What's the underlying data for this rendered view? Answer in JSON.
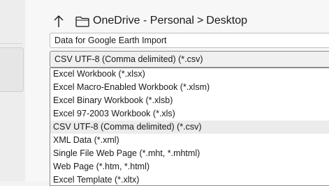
{
  "breadcrumb": {
    "location": "OneDrive - Personal",
    "separator": ">",
    "folder": "Desktop"
  },
  "icons": {
    "up": "up-arrow-icon",
    "folder": "folder-icon"
  },
  "file_name": {
    "value": "Data for Google Earth Import"
  },
  "save_as_type": {
    "selected": "CSV UTF-8 (Comma delimited) (*.csv)",
    "options": [
      "Excel Workbook (*.xlsx)",
      "Excel Macro-Enabled Workbook (*.xlsm)",
      "Excel Binary Workbook (*.xlsb)",
      "Excel 97-2003 Workbook (*.xls)",
      "CSV UTF-8 (Comma delimited) (*.csv)",
      "XML Data (*.xml)",
      "Single File Web Page (*.mht, *.mhtml)",
      "Web Page (*.htm, *.html)",
      "Excel Template (*.xltx)"
    ],
    "highlighted_index": 4
  },
  "colors": {
    "highlight": "#ececec",
    "border": "#8a8a8a"
  }
}
